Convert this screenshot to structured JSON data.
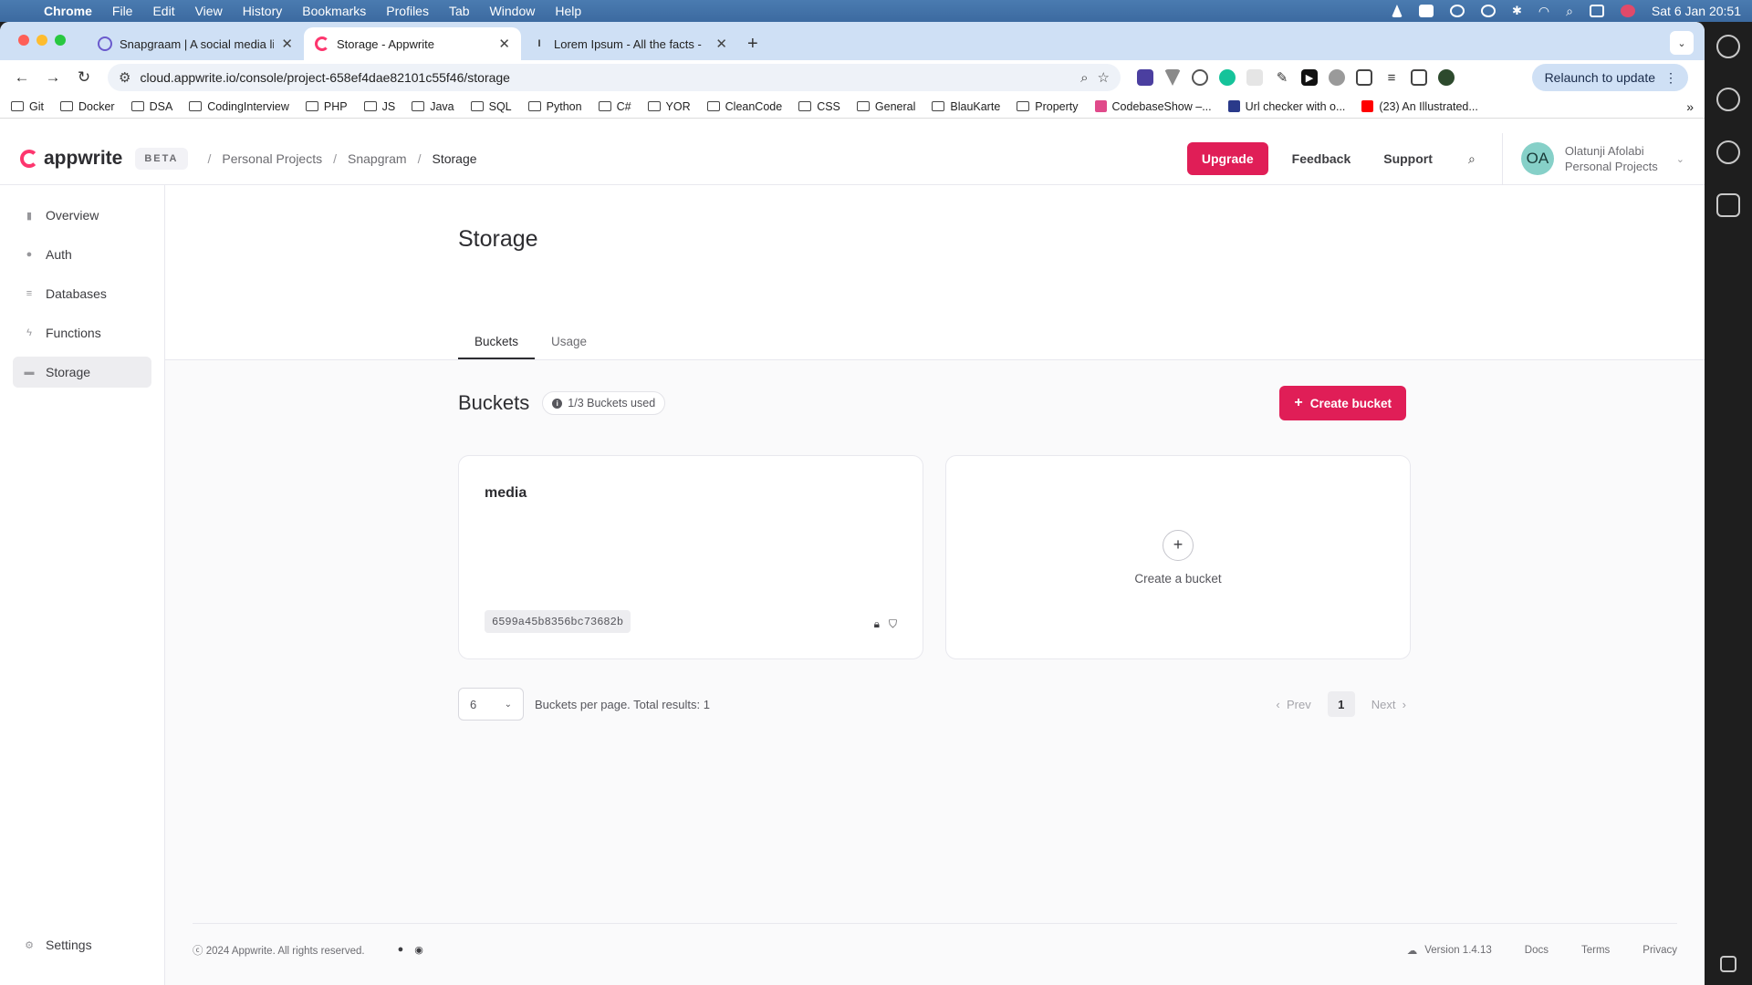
{
  "menubar": {
    "items": [
      "Chrome",
      "File",
      "Edit",
      "View",
      "History",
      "Bookmarks",
      "Profiles",
      "Tab",
      "Window",
      "Help"
    ],
    "datetime": "Sat 6 Jan  20:51"
  },
  "tabs": [
    {
      "title": "Snapgraam | A social media li",
      "icon": "snapgram-icon"
    },
    {
      "title": "Storage - Appwrite",
      "icon": "appwrite-icon"
    },
    {
      "title": "Lorem Ipsum - All the facts -",
      "icon": "lorem-icon"
    }
  ],
  "omnibox": {
    "url": "cloud.appwrite.io/console/project-658ef4dae82101c55f46/storage"
  },
  "relaunch_label": "Relaunch to update",
  "bookmarks": [
    "Git",
    "Docker",
    "DSA",
    "CodingInterview",
    "PHP",
    "JS",
    "Java",
    "SQL",
    "Python",
    "C#",
    "YOR",
    "CleanCode",
    "CSS",
    "General",
    "BlauKarte",
    "Property"
  ],
  "bookmark_links": [
    "CodebaseShow –...",
    "Url checker with o...",
    "(23) An Illustrated..."
  ],
  "topbar": {
    "logo": "appwrite",
    "beta": "BETA",
    "breadcrumb": [
      "Personal Projects",
      "Snapgram",
      "Storage"
    ],
    "upgrade": "Upgrade",
    "feedback": "Feedback",
    "support": "Support",
    "account": {
      "initials": "OA",
      "name": "Olatunji Afolabi",
      "org": "Personal Projects"
    }
  },
  "sidebar": {
    "items": [
      {
        "label": "Overview",
        "icon": "chart-icon"
      },
      {
        "label": "Auth",
        "icon": "users-icon"
      },
      {
        "label": "Databases",
        "icon": "database-icon"
      },
      {
        "label": "Functions",
        "icon": "lightning-icon"
      },
      {
        "label": "Storage",
        "icon": "folder-icon",
        "active": true
      }
    ],
    "settings": "Settings"
  },
  "page": {
    "title": "Storage",
    "tabs": [
      "Buckets",
      "Usage"
    ],
    "section_title": "Buckets",
    "usage": "1/3 Buckets used",
    "create_button": "Create bucket"
  },
  "buckets": [
    {
      "name": "media",
      "id": "6599a45b8356bc73682b"
    }
  ],
  "create_card_label": "Create a bucket",
  "pagination": {
    "per_page": "6",
    "summary": "Buckets per page. Total results: 1",
    "prev": "Prev",
    "current": "1",
    "next": "Next"
  },
  "footer": {
    "copyright": "ⓒ 2024 Appwrite. All rights reserved.",
    "version": "Version 1.4.13",
    "links": [
      "Docs",
      "Terms",
      "Privacy"
    ]
  },
  "colors": {
    "accent": "#e01e57",
    "brand": "#fd366e"
  }
}
